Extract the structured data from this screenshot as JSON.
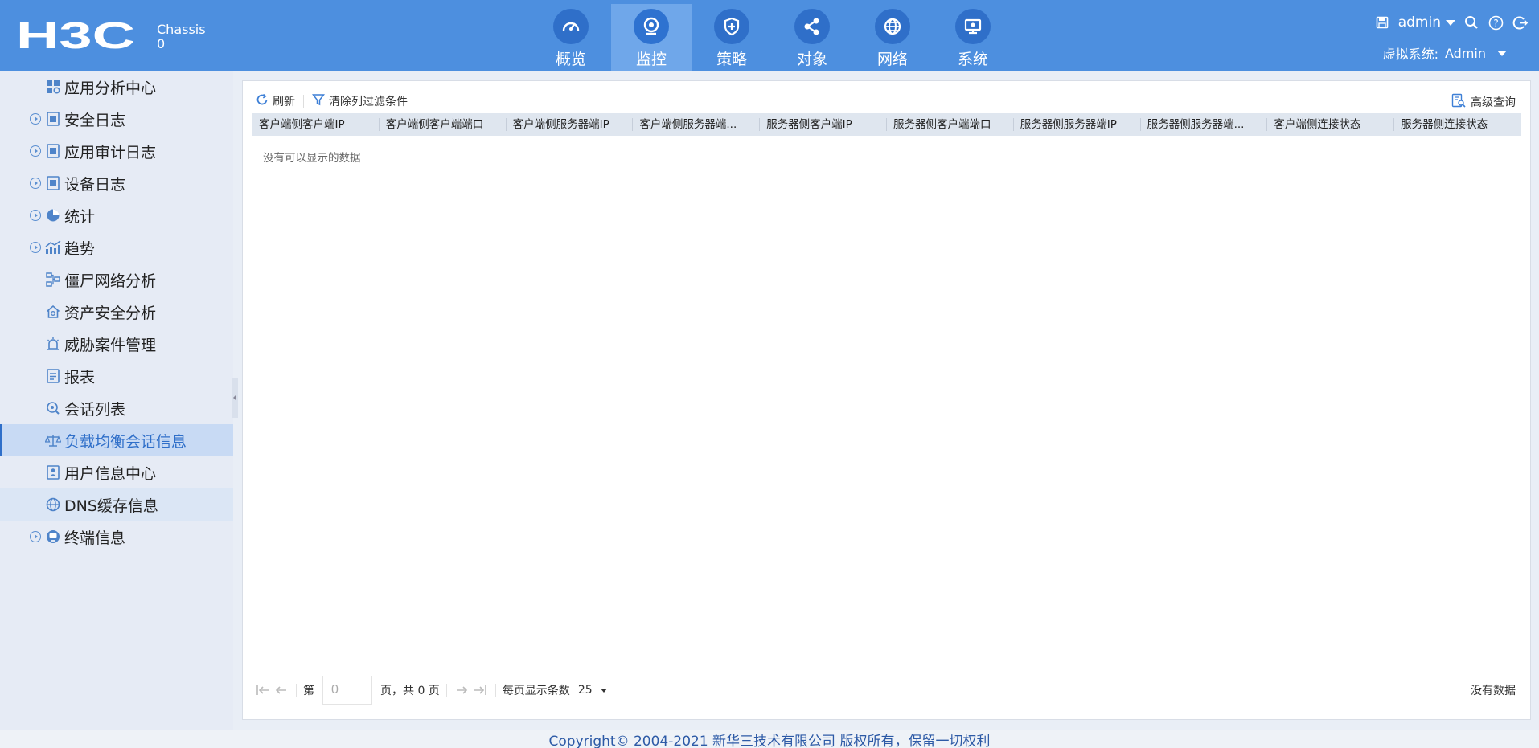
{
  "header": {
    "logo_text": "H3C",
    "chassis_line1": "Chassis",
    "chassis_line2": "0",
    "nav": [
      {
        "label": "概览",
        "icon": "gauge-icon"
      },
      {
        "label": "监控",
        "icon": "camera-icon",
        "active": true
      },
      {
        "label": "策略",
        "icon": "shield-icon"
      },
      {
        "label": "对象",
        "icon": "share-icon"
      },
      {
        "label": "网络",
        "icon": "globe-icon"
      },
      {
        "label": "系统",
        "icon": "monitor-icon"
      }
    ],
    "user": "admin",
    "vsys_label": "虚拟系统:",
    "vsys_value": "Admin"
  },
  "sidebar": {
    "items": [
      {
        "label": "应用分析中心",
        "icon": "app-grid-icon",
        "expandable": false
      },
      {
        "label": "安全日志",
        "icon": "log-icon",
        "expandable": true
      },
      {
        "label": "应用审计日志",
        "icon": "log-icon",
        "expandable": true
      },
      {
        "label": "设备日志",
        "icon": "log-icon",
        "expandable": true
      },
      {
        "label": "统计",
        "icon": "pie-chart-icon",
        "expandable": true
      },
      {
        "label": "趋势",
        "icon": "trend-chart-icon",
        "expandable": true
      },
      {
        "label": "僵尸网络分析",
        "icon": "network-icon",
        "expandable": false
      },
      {
        "label": "资产安全分析",
        "icon": "home-icon",
        "expandable": false
      },
      {
        "label": "威胁案件管理",
        "icon": "alarm-icon",
        "expandable": false
      },
      {
        "label": "报表",
        "icon": "report-icon",
        "expandable": false
      },
      {
        "label": "会话列表",
        "icon": "session-icon",
        "expandable": false
      },
      {
        "label": "负载均衡会话信息",
        "icon": "balance-icon",
        "expandable": false,
        "active": true
      },
      {
        "label": "用户信息中心",
        "icon": "user-doc-icon",
        "expandable": false
      },
      {
        "label": "DNS缓存信息",
        "icon": "dns-icon",
        "expandable": false
      },
      {
        "label": "终端信息",
        "icon": "terminal-icon",
        "expandable": true
      }
    ]
  },
  "toolbar": {
    "refresh_label": "刷新",
    "clear_filter_label": "清除列过滤条件",
    "advanced_query_label": "高级查询"
  },
  "table": {
    "columns": [
      "客户端侧客户端IP",
      "客户端侧客户端端口",
      "客户端侧服务器端IP",
      "客户端侧服务器端...",
      "服务器侧客户端IP",
      "服务器侧客户端端口",
      "服务器侧服务器端IP",
      "服务器侧服务器端...",
      "客户端侧连接状态",
      "服务器侧连接状态"
    ],
    "empty_text": "没有可以显示的数据"
  },
  "pager": {
    "page_prefix": "第",
    "page_value": "0",
    "page_suffix": "页，共 0 页",
    "per_page_label": "每页显示条数",
    "per_page_value": "25",
    "status": "没有数据"
  },
  "footer": {
    "copyright": "Copyright© 2004-2021 新华三技术有限公司 版权所有，保留一切权利"
  }
}
